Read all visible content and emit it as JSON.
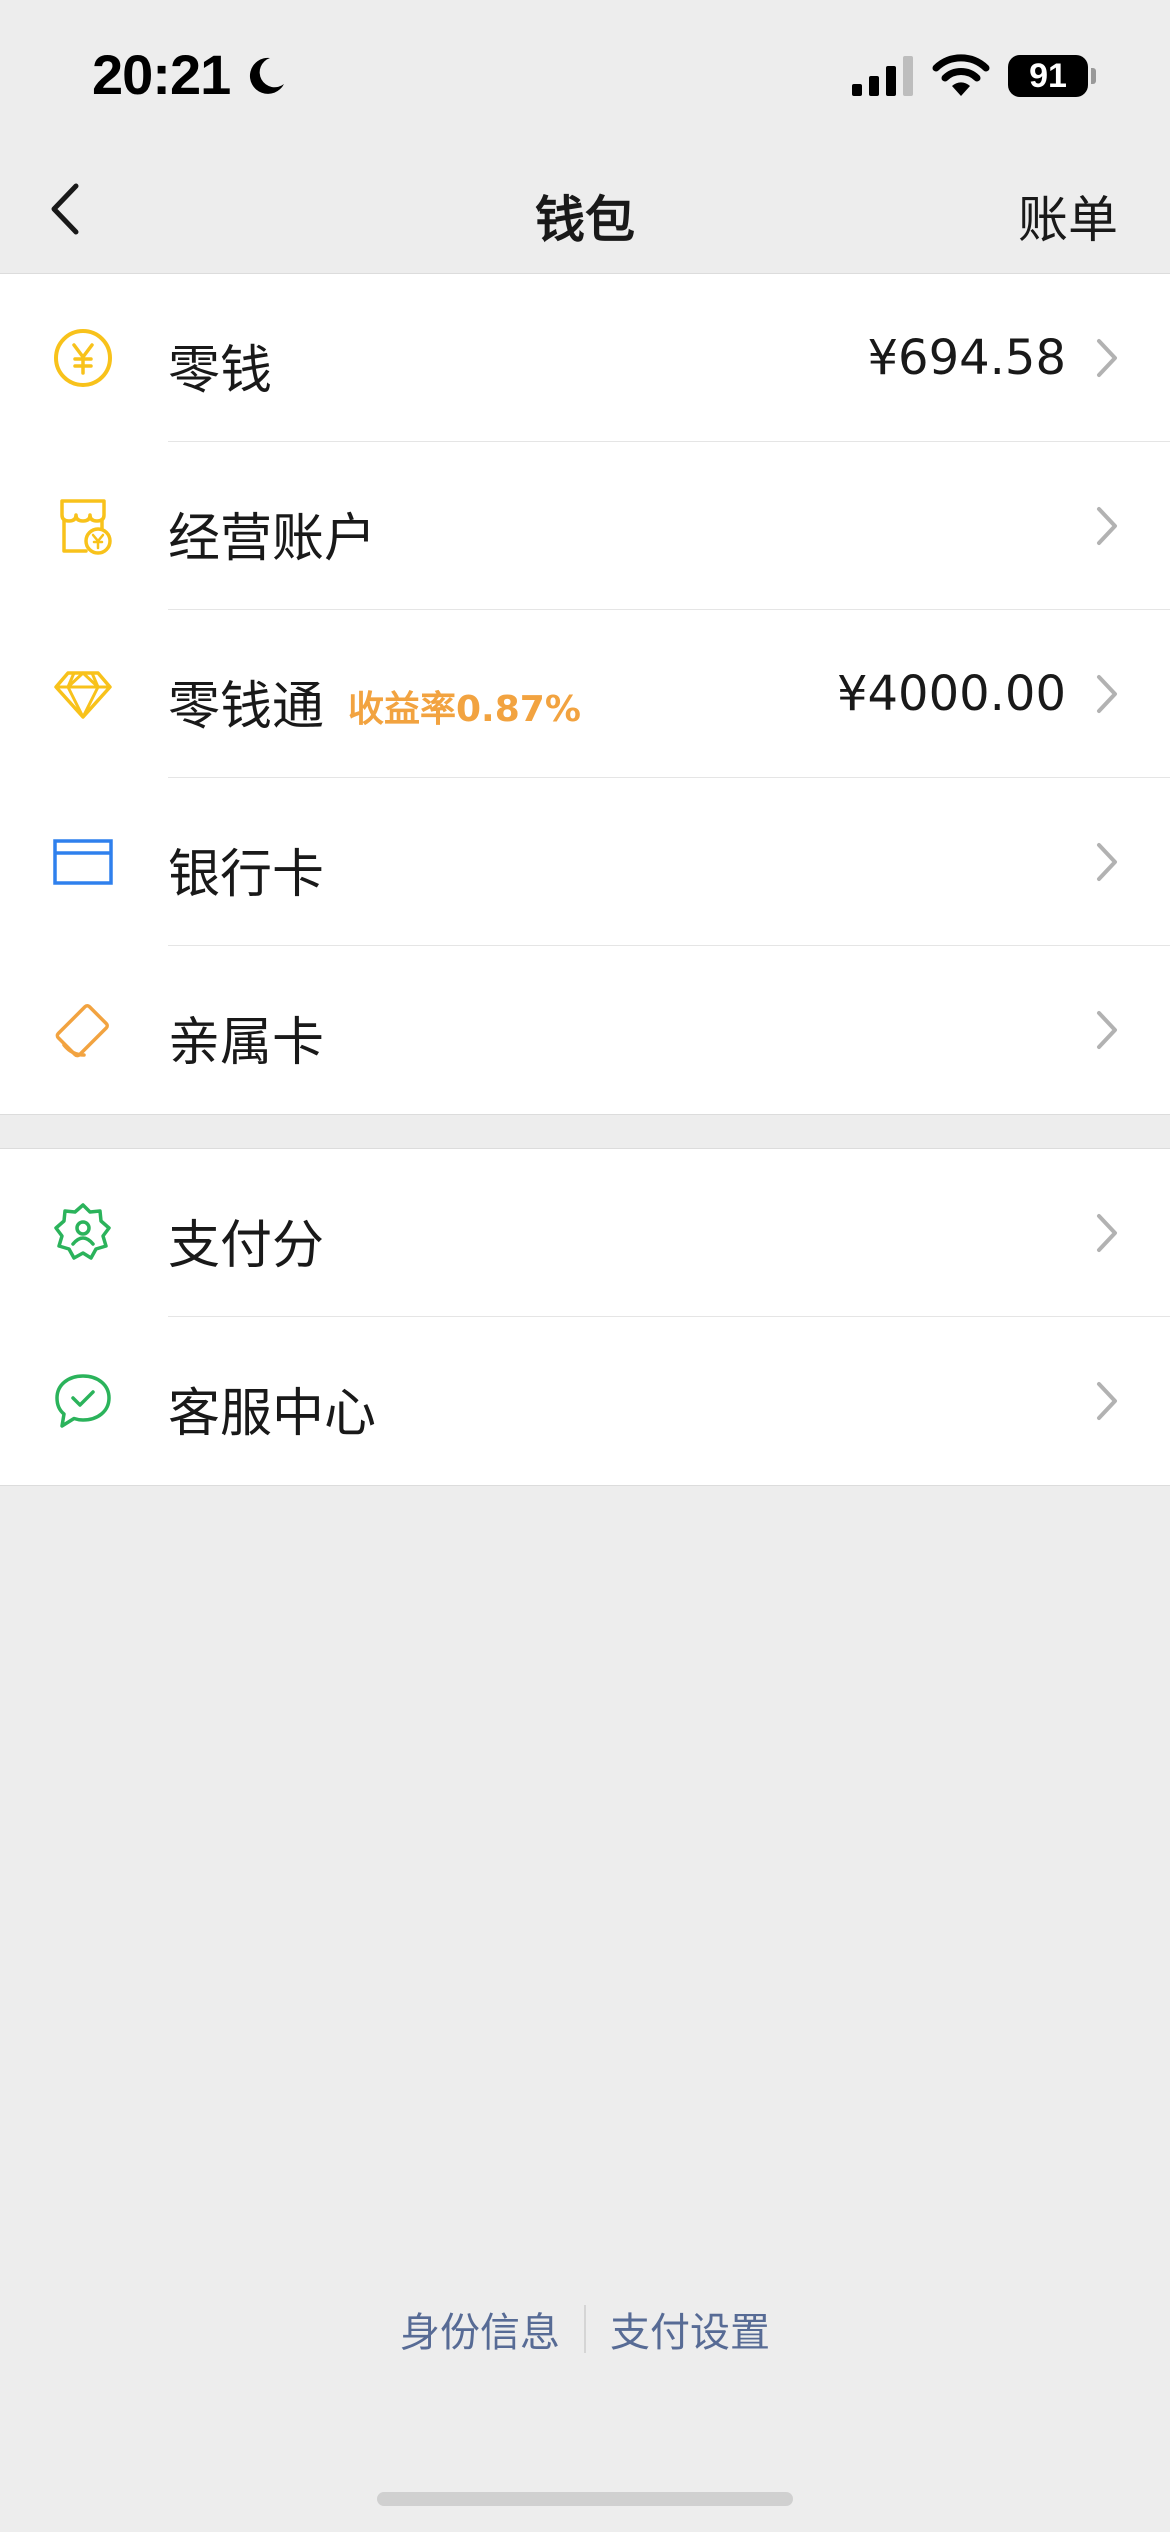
{
  "status_bar": {
    "time": "20:21",
    "battery_level": "91"
  },
  "nav": {
    "title": "钱包",
    "bill_label": "账单"
  },
  "group1": [
    {
      "label": "零钱",
      "value": "¥694.58",
      "icon": "yuan-coin-icon"
    },
    {
      "label": "经营账户",
      "value": "",
      "icon": "shop-account-icon"
    },
    {
      "label": "零钱通",
      "rate": "收益率0.87%",
      "value": "¥4000.00",
      "icon": "diamond-icon"
    },
    {
      "label": "银行卡",
      "value": "",
      "icon": "bank-card-icon"
    },
    {
      "label": "亲属卡",
      "value": "",
      "icon": "family-card-icon"
    }
  ],
  "group2": [
    {
      "label": "支付分",
      "value": "",
      "icon": "pay-score-badge-icon"
    },
    {
      "label": "客服中心",
      "value": "",
      "icon": "customer-service-icon"
    }
  ],
  "footer": {
    "identity_label": "身份信息",
    "pay_settings_label": "支付设置"
  },
  "colors": {
    "background": "#ededed",
    "card": "#ffffff",
    "yellow_icon": "#f8c21b",
    "orange_icon": "#f2a340",
    "blue_icon": "#2f80ed",
    "green_icon": "#2bb35b",
    "rate_text": "#f2a340",
    "link": "#576b95",
    "chevron": "#b2b2b2"
  }
}
